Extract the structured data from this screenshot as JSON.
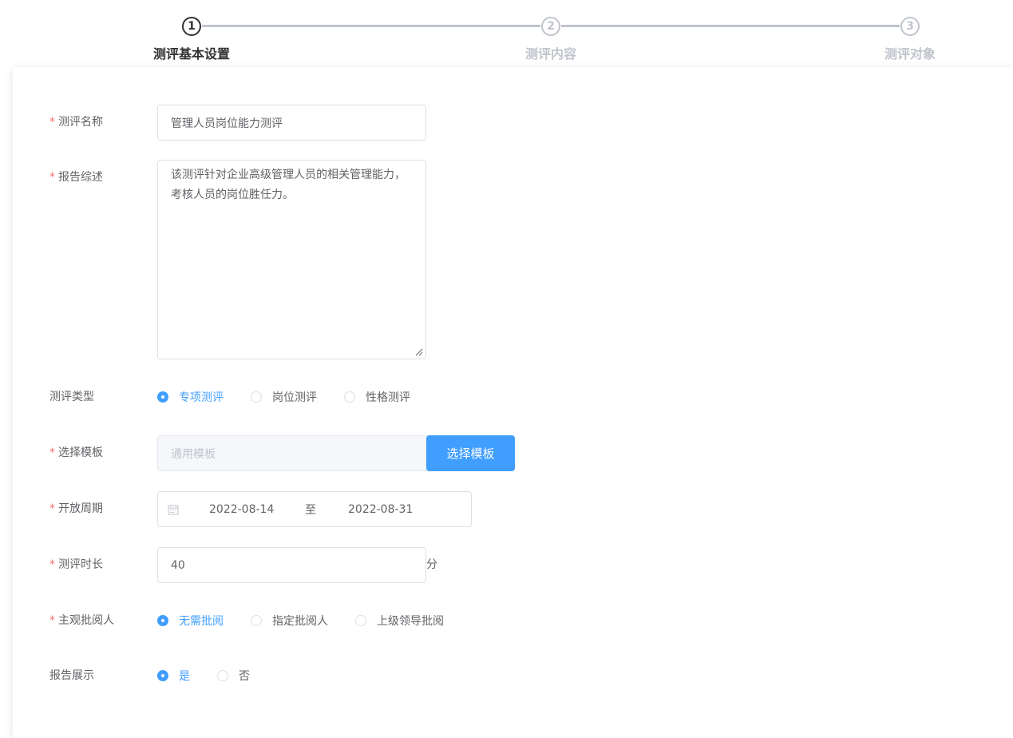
{
  "steps": [
    {
      "number": "1",
      "title": "测评基本设置"
    },
    {
      "number": "2",
      "title": "测评内容"
    },
    {
      "number": "3",
      "title": "测评对象"
    }
  ],
  "form": {
    "required_mark": "*",
    "name": {
      "label": "测评名称",
      "value": "管理人员岗位能力测评"
    },
    "summary": {
      "label": "报告综述",
      "value": "该测评针对企业高级管理人员的相关管理能力，考核人员的岗位胜任力。"
    },
    "type": {
      "label": "测评类型",
      "options": [
        "专项测评",
        "岗位测评",
        "性格测评"
      ],
      "selected": "专项测评"
    },
    "template": {
      "label": "选择模板",
      "placeholder": "通用模板",
      "button": "选择模板"
    },
    "period": {
      "label": "开放周期",
      "start": "2022-08-14",
      "separator": "至",
      "end": "2022-08-31"
    },
    "duration": {
      "label": "测评时长",
      "value": "40",
      "unit": "分"
    },
    "reviewer": {
      "label": "主观批阅人",
      "options": [
        "无需批阅",
        "指定批阅人",
        "上级领导批阅"
      ],
      "selected": "无需批阅"
    },
    "report_display": {
      "label": "报告展示",
      "options": [
        "是",
        "否"
      ],
      "selected": "是"
    }
  },
  "icons": {
    "calendar": "calendar-icon"
  },
  "colors": {
    "primary": "#409eff",
    "required": "#f56c6c",
    "active_step": "#303133",
    "inactive_step": "#c0c4cc"
  }
}
